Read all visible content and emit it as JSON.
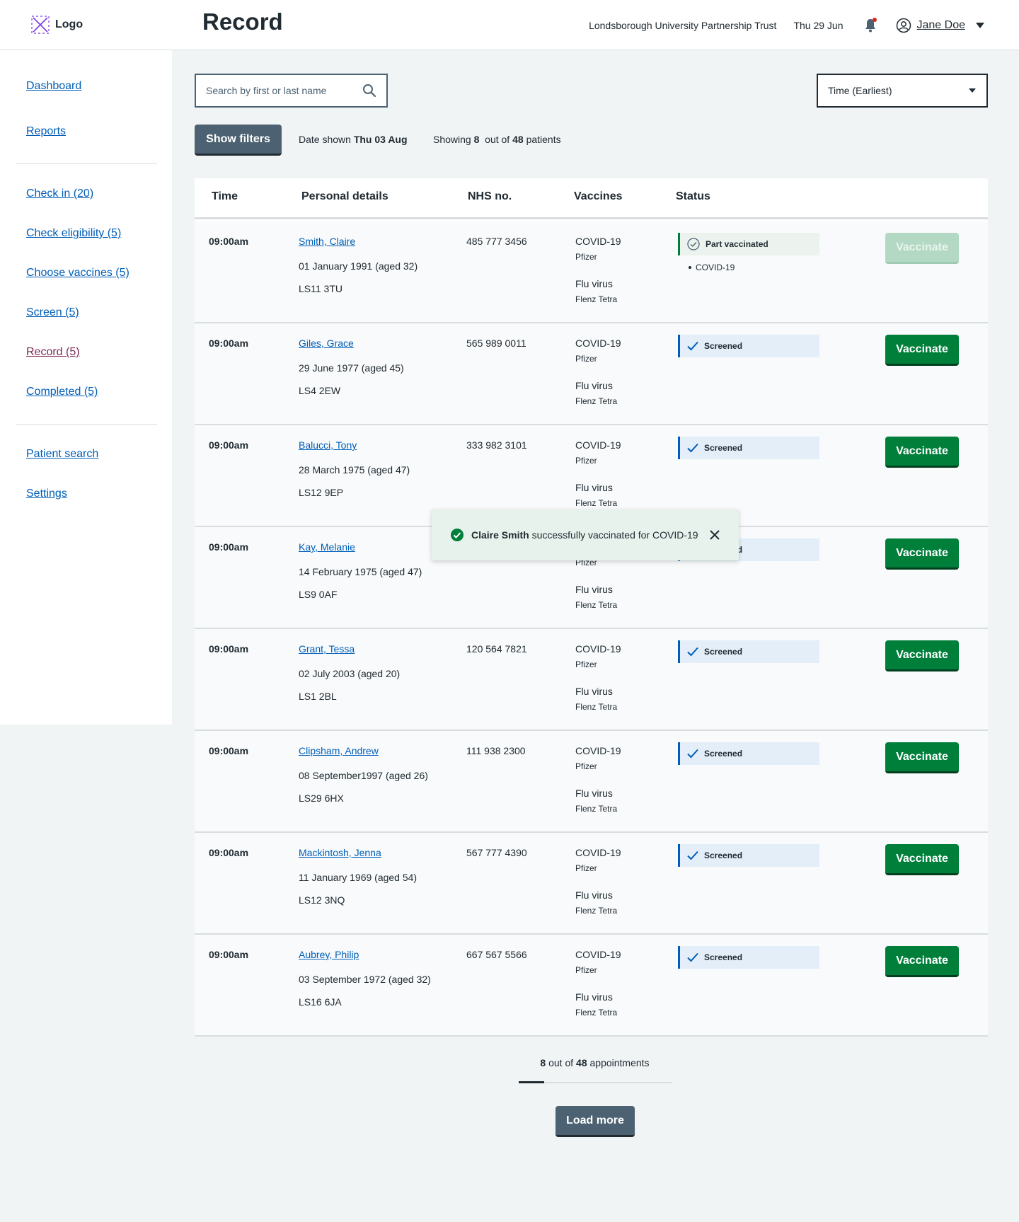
{
  "header": {
    "logo_text": "Logo",
    "page_title": "Record",
    "trust": "Londsborough University Partnership Trust",
    "date": "Thu 29 Jun",
    "user_name": "Jane Doe"
  },
  "sidebar": {
    "items": [
      {
        "label": "Dashboard"
      },
      {
        "label": "Reports"
      },
      {
        "label": "Check in (20)"
      },
      {
        "label": "Check eligibility (5)"
      },
      {
        "label": "Choose vaccines (5)"
      },
      {
        "label": "Screen (5)"
      },
      {
        "label": "Record (5)",
        "active": true
      },
      {
        "label": "Completed (5)"
      },
      {
        "label": "Patient search"
      },
      {
        "label": "Settings"
      }
    ]
  },
  "controls": {
    "search_placeholder": "Search by first or last name",
    "sort_value": "Time (Earliest)",
    "show_filters": "Show filters",
    "date_shown_label": "Date shown",
    "date_shown_value": "Thu 03 Aug",
    "showing_label": "Showing",
    "showing_count": "8",
    "showing_of": "out of",
    "showing_total": "48",
    "showing_suffix": "patients"
  },
  "table": {
    "headers": [
      "Time",
      "Personal details",
      "NHS no.",
      "Vaccines",
      "Status"
    ],
    "rows": [
      {
        "time": "09:00am",
        "name": "Smith, Claire",
        "dob": "01 January 1991 (aged 32)",
        "postcode": "LS11 3TU",
        "nhs": "485 777 3456",
        "vaccine1": "COVID-19",
        "brand1": "Pfizer",
        "vaccine2": "Flu virus",
        "brand2": "Flenz Tetra",
        "status": "Part vaccinated",
        "status_sub": "COVID-19",
        "action": "Vaccinate",
        "disabled": true
      },
      {
        "time": "09:00am",
        "name": "Giles, Grace",
        "dob": "29 June 1977 (aged 45)",
        "postcode": "LS4 2EW",
        "nhs": "565 989 0011",
        "vaccine1": "COVID-19",
        "brand1": "Pfizer",
        "vaccine2": "Flu virus",
        "brand2": "Flenz Tetra",
        "status": "Screened",
        "action": "Vaccinate"
      },
      {
        "time": "09:00am",
        "name": "Balucci, Tony",
        "dob": "28 March 1975 (aged 47)",
        "postcode": "LS12 9EP",
        "nhs": "333 982 3101",
        "vaccine1": "COVID-19",
        "brand1": "Pfizer",
        "vaccine2": "Flu virus",
        "brand2": "Flenz Tetra",
        "status": "Screened",
        "action": "Vaccinate"
      },
      {
        "time": "09:00am",
        "name": "Kay, Melanie",
        "dob": "14 February 1975 (aged 47)",
        "postcode": "LS9 0AF",
        "nhs": "",
        "vaccine1": "",
        "brand1": "Pfizer",
        "vaccine2": "Flu virus",
        "brand2": "Flenz Tetra",
        "status": "Screened",
        "action": "Vaccinate"
      },
      {
        "time": "09:00am",
        "name": "Grant, Tessa",
        "dob": "02 July 2003 (aged 20)",
        "postcode": "LS1 2BL",
        "nhs": "120 564 7821",
        "vaccine1": "COVID-19",
        "brand1": "Pfizer",
        "vaccine2": "Flu virus",
        "brand2": "Flenz Tetra",
        "status": "Screened",
        "action": "Vaccinate"
      },
      {
        "time": "09:00am",
        "name": "Clipsham, Andrew",
        "dob": "08 September1997 (aged 26)",
        "postcode": "LS29 6HX",
        "nhs": "111 938 2300",
        "vaccine1": "COVID-19",
        "brand1": "Pfizer",
        "vaccine2": "Flu virus",
        "brand2": "Flenz Tetra",
        "status": "Screened",
        "action": "Vaccinate"
      },
      {
        "time": "09:00am",
        "name": "Mackintosh, Jenna",
        "dob": "11 January 1969 (aged 54)",
        "postcode": "LS12 3NQ",
        "nhs": "567 777 4390",
        "vaccine1": "COVID-19",
        "brand1": "Pfizer",
        "vaccine2": "Flu virus",
        "brand2": "Flenz Tetra",
        "status": "Screened",
        "action": "Vaccinate"
      },
      {
        "time": "09:00am",
        "name": "Aubrey, Philip",
        "dob": "03 September 1972 (aged 32)",
        "postcode": "LS16 6JA",
        "nhs": "667 567 5566",
        "vaccine1": "COVID-19",
        "brand1": "Pfizer",
        "vaccine2": "Flu virus",
        "brand2": "Flenz Tetra",
        "status": "Screened",
        "action": "Vaccinate"
      }
    ]
  },
  "toast": {
    "name": "Claire Smith",
    "message": "successfully vaccinated for COVID-19"
  },
  "footer": {
    "count_shown": "8",
    "count_of": "out of",
    "count_total": "48",
    "count_suffix": "appointments",
    "progress": 0.1667,
    "load_more": "Load more"
  },
  "colors": {
    "link": "#005eb8",
    "active_link": "#7c2855",
    "primary_green": "#007f3b",
    "secondary_button": "#4c6272",
    "screened_bg": "#e3eef8",
    "toast_bg": "#e6f2eb"
  }
}
